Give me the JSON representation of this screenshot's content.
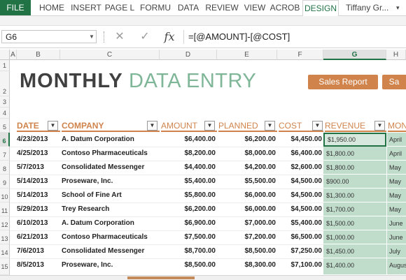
{
  "ribbon": {
    "file": "FILE",
    "tabs": [
      "HOME",
      "INSERT",
      "PAGE L",
      "FORMU",
      "DATA",
      "REVIEW",
      "VIEW",
      "ACROB",
      "DESIGN"
    ],
    "active_tab": "DESIGN",
    "user": "Tiffany Gr...",
    "accent": "#217346"
  },
  "formula_bar": {
    "cell_ref": "G6",
    "cancel_symbol": "✕",
    "enter_symbol": "✓",
    "fx_symbol": "fx",
    "formula": "=[@AMOUNT]-[@COST]"
  },
  "grid": {
    "columns": [
      "A",
      "B",
      "C",
      "D",
      "E",
      "F",
      "G",
      "H"
    ],
    "selected_column": "G",
    "rows": [
      "1",
      "2",
      "3",
      "4",
      "5",
      "6",
      "7",
      "8",
      "9",
      "10",
      "11",
      "12",
      "13",
      "14",
      "15"
    ],
    "selected_row": "6"
  },
  "title": {
    "bold": "MONTHLY",
    "light": "DATA ENTRY",
    "bold_color": "#404040",
    "light_color": "#7fb698"
  },
  "buttons": {
    "sales_report": "Sales Report",
    "second": "Sa",
    "color": "#d0844c"
  },
  "table": {
    "headers": {
      "date": "DATE",
      "company": "COMPANY",
      "amount": "AMOUNT",
      "planned": "PLANNED",
      "cost": "COST",
      "revenue": "REVENUE",
      "month": "MON"
    },
    "header_color": "#d0844c",
    "revenue_fill": "#c0dccb",
    "rows": [
      {
        "date": "4/23/2013",
        "company": "A. Datum Corporation",
        "amount": "$6,400.00",
        "planned": "$6,200.00",
        "cost": "$4,450.00",
        "revenue": "$1,950.00",
        "month": "April"
      },
      {
        "date": "4/25/2013",
        "company": "Contoso Pharmaceuticals",
        "amount": "$8,200.00",
        "planned": "$8,000.00",
        "cost": "$6,400.00",
        "revenue": "$1,800.00",
        "month": "April"
      },
      {
        "date": "5/7/2013",
        "company": "Consolidated Messenger",
        "amount": "$4,400.00",
        "planned": "$4,200.00",
        "cost": "$2,600.00",
        "revenue": "$1,800.00",
        "month": "May"
      },
      {
        "date": "5/14/2013",
        "company": "Proseware, Inc.",
        "amount": "$5,400.00",
        "planned": "$5,500.00",
        "cost": "$4,500.00",
        "revenue": "$900.00",
        "month": "May"
      },
      {
        "date": "5/14/2013",
        "company": "School of Fine Art",
        "amount": "$5,800.00",
        "planned": "$6,000.00",
        "cost": "$4,500.00",
        "revenue": "$1,300.00",
        "month": "May"
      },
      {
        "date": "5/29/2013",
        "company": "Trey Research",
        "amount": "$6,200.00",
        "planned": "$6,000.00",
        "cost": "$4,500.00",
        "revenue": "$1,700.00",
        "month": "May"
      },
      {
        "date": "6/10/2013",
        "company": "A. Datum Corporation",
        "amount": "$6,900.00",
        "planned": "$7,000.00",
        "cost": "$5,400.00",
        "revenue": "$1,500.00",
        "month": "June"
      },
      {
        "date": "6/21/2013",
        "company": "Contoso Pharmaceuticals",
        "amount": "$7,500.00",
        "planned": "$7,200.00",
        "cost": "$6,500.00",
        "revenue": "$1,000.00",
        "month": "June"
      },
      {
        "date": "7/6/2013",
        "company": "Consolidated Messenger",
        "amount": "$8,700.00",
        "planned": "$8,500.00",
        "cost": "$7,250.00",
        "revenue": "$1,450.00",
        "month": "July"
      },
      {
        "date": "8/5/2013",
        "company": "Proseware, Inc.",
        "amount": "$8,500.00",
        "planned": "$8,300.00",
        "cost": "$7,100.00",
        "revenue": "$1,400.00",
        "month": "August"
      }
    ]
  }
}
